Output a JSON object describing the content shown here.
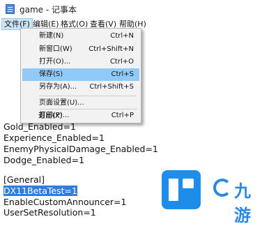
{
  "window": {
    "title": "game - 记事本"
  },
  "menubar": [
    {
      "label": "文件(F)",
      "active": true
    },
    {
      "label": "编辑(E)"
    },
    {
      "label": "格式(O)"
    },
    {
      "label": "查看(V)"
    },
    {
      "label": "帮助(H)"
    }
  ],
  "file_menu": {
    "items": [
      {
        "label": "新建(N)",
        "shortcut": "Ctrl+N"
      },
      {
        "label": "新窗口(W)",
        "shortcut": "Ctrl+Shift+N"
      },
      {
        "label": "打开(O)...",
        "shortcut": "Ctrl+O"
      },
      {
        "label": "保存(S)",
        "shortcut": "Ctrl+S",
        "highlighted": true
      },
      {
        "label": "另存为(A)...",
        "shortcut": "Ctrl+Shift+S"
      },
      {
        "label": "页面设置(U)...",
        "shortcut": ""
      },
      {
        "label": "打印(P)...",
        "shortcut": "Ctrl+P"
      },
      {
        "label": "退出(X)",
        "shortcut": ""
      }
    ]
  },
  "document": {
    "lines": [
      "Gold_Enabled=1",
      "Experience_Enabled=1",
      "EnemyPhysicalDamage_Enabled=1",
      "Dodge_Enabled=1",
      "",
      "[General]",
      "DX11BetaTest=1",
      "EnableCustomAnnouncer=1",
      "UserSetResolution=1"
    ]
  },
  "watermark": {
    "text": "九游"
  },
  "colors": {
    "highlight": "#91c9f7",
    "selection": "#2f7de1",
    "menu_active": "#cce4f7"
  }
}
